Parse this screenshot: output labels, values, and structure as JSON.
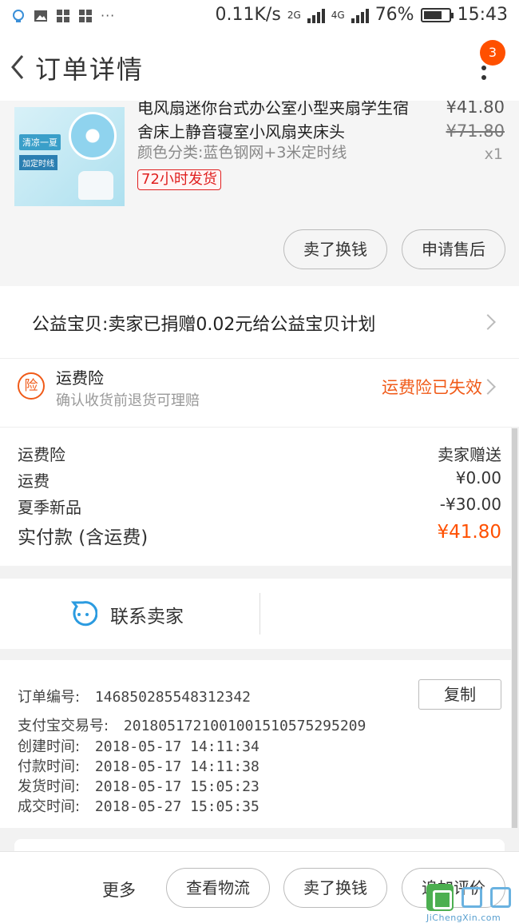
{
  "statusbar": {
    "speed": "0.11K/s",
    "net1": "2G",
    "net2": "4G",
    "battery": "76%",
    "battery_level": 0.76,
    "time": "15:43",
    "dots": "···"
  },
  "nav": {
    "title": "订单详情",
    "badge": "3"
  },
  "product": {
    "title": "电风扇迷你台式办公室小型夹扇学生宿舍床上静音寝室小风扇夹床头",
    "sku": "颜色分类:蓝色钢网+3米定时线",
    "tag": "72小时发货",
    "price": "¥41.80",
    "original_price": "¥71.80",
    "quantity": "x1",
    "thumb_text1": "清凉一夏",
    "thumb_text2": "加定时线",
    "btn_sell": "卖了换钱",
    "btn_aftersale": "申请售后"
  },
  "charity": {
    "text": "公益宝贝:卖家已捐赠0.02元给公益宝贝计划"
  },
  "insurance": {
    "icon_text": "险",
    "title": "运费险",
    "subtitle": "确认收货前退货可理赔",
    "status": "运费险已失效"
  },
  "costs": {
    "rows": [
      {
        "label": "运费险",
        "value": "卖家赠送"
      },
      {
        "label": "运费",
        "value": "¥0.00"
      },
      {
        "label": "夏季新品",
        "value": "-¥30.00"
      }
    ],
    "total_label": "实付款 (含运费)",
    "total_value": "¥41.80"
  },
  "contact": {
    "label": "联系卖家"
  },
  "order_info": {
    "copy": "复制",
    "rows": [
      {
        "label": "订单编号:",
        "value": "146850285548312342"
      },
      {
        "label": "支付宝交易号:",
        "value": "2018051721001001510575295209"
      },
      {
        "label": "创建时间:",
        "value": "2018-05-17 14:11:34"
      },
      {
        "label": "付款时间:",
        "value": "2018-05-17 14:11:38"
      },
      {
        "label": "发货时间:",
        "value": "2018-05-17 15:05:23"
      },
      {
        "label": "成交时间:",
        "value": "2018-05-27 15:05:35"
      }
    ]
  },
  "bottom": {
    "more": "更多",
    "logistics": "查看物流",
    "sell": "卖了换钱",
    "review": "追加评价"
  },
  "watermark": {
    "text": "JiChengXin.com"
  },
  "colors": {
    "accent": "#ff5000",
    "insurance": "#f05a18",
    "tag_red": "#e02020",
    "contact_blue": "#2b9be0"
  }
}
